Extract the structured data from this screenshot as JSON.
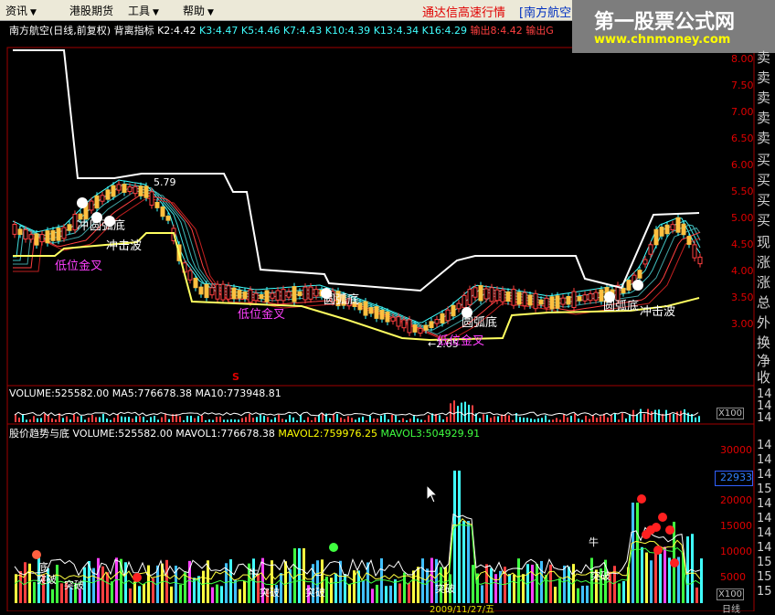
{
  "menubar": {
    "items": [
      {
        "label": "资讯",
        "has_arrow": true
      },
      {
        "label": "港股期货",
        "has_arrow": false
      },
      {
        "label": "工具",
        "has_arrow": true
      },
      {
        "label": "帮助",
        "has_arrow": true
      }
    ],
    "ticker": "通达信高速行情",
    "ticker_stock": "[南方航空"
  },
  "watermark": {
    "title": "第一股票公式网",
    "url": "www.chnmoney.com"
  },
  "main_panel": {
    "header_prefix": "南方航空(日线,前复权) 背离指标",
    "indicators": [
      {
        "label": "K2:4.42",
        "color": "#ffffff"
      },
      {
        "label": "K3:4.47",
        "color": "#40ffff"
      },
      {
        "label": "K5:4.46",
        "color": "#40ffff"
      },
      {
        "label": "K7:4.43",
        "color": "#40ffff"
      },
      {
        "label": "K10:4.39",
        "color": "#40ffff"
      },
      {
        "label": "K13:4.34",
        "color": "#40ffff"
      },
      {
        "label": "K16:4.29",
        "color": "#40ffff"
      },
      {
        "label": "输出8:4.42",
        "color": "#ff4040"
      },
      {
        "label": "输出G",
        "color": "#ff4040"
      }
    ],
    "y_axis": [
      "8.00",
      "7.50",
      "7.00",
      "6.50",
      "6.00",
      "5.50",
      "5.00",
      "4.50",
      "4.00",
      "3.50",
      "3.00"
    ],
    "price_annotations": [
      {
        "text": "5.79",
        "color": "#ffffff"
      },
      {
        "text": "←2.65",
        "color": "#ffffff"
      }
    ],
    "annotations": [
      {
        "text": "冲",
        "color": "#ffffff"
      },
      {
        "text": "圆弧底",
        "color": "#ffffff"
      },
      {
        "text": "冲击波",
        "color": "#ffffff"
      },
      {
        "text": "低位金叉",
        "color": "#ff40ff"
      },
      {
        "text": "低位金叉",
        "color": "#ff40ff"
      },
      {
        "text": "圆弧底",
        "color": "#ffffff"
      },
      {
        "text": "圆弧底",
        "color": "#ffffff"
      },
      {
        "text": "低位金叉",
        "color": "#ff40ff"
      },
      {
        "text": "圆弧底",
        "color": "#ffffff"
      },
      {
        "text": "冲击波",
        "color": "#ffffff"
      }
    ],
    "s_marker": "S"
  },
  "right_panel": {
    "labels": [
      "卖",
      "卖",
      "卖",
      "卖",
      "卖",
      "买",
      "买",
      "买",
      "买",
      "现",
      "涨",
      "涨",
      "总",
      "外",
      "换",
      "净",
      "收"
    ]
  },
  "volume_panel": {
    "header": [
      {
        "label": "VOLUME:525582.00",
        "color": "#ffffff"
      },
      {
        "label": "MA5:776678.38",
        "color": "#ffffff"
      },
      {
        "label": "MA10:773948.81",
        "color": "#ffffff"
      }
    ],
    "right_labels": [
      "14",
      "14",
      "14",
      "14"
    ],
    "badge": "X100"
  },
  "trend_panel": {
    "header": [
      {
        "label": "股价趋势与底 VOLUME:525582.00",
        "color": "#ffffff"
      },
      {
        "label": "MAVOL1:776678.38",
        "color": "#ffffff"
      },
      {
        "label": "MAVOL2:759976.25",
        "color": "#ffff00"
      },
      {
        "label": "MAVOL3:504929.91",
        "color": "#40ff40"
      }
    ],
    "y_axis": [
      "30000",
      "25000",
      "20000",
      "15000",
      "10000",
      "5000"
    ],
    "readout": "22933",
    "badge": "X100",
    "right_labels": [
      "14",
      "14",
      "14",
      "15",
      "14",
      "14",
      "14",
      "14",
      "15",
      "15",
      "15",
      "15"
    ],
    "annotations": [
      {
        "text": "底",
        "color": "#ffffff"
      },
      {
        "text": "突破",
        "color": "#ffffff"
      },
      {
        "text": "突破",
        "color": "#ffffff"
      },
      {
        "text": "牛",
        "color": "#ffffff"
      },
      {
        "text": "突破",
        "color": "#ffffff"
      },
      {
        "text": "突破",
        "color": "#ffffff"
      },
      {
        "text": "突破",
        "color": "#ffffff"
      },
      {
        "text": "牛",
        "color": "#ffffff"
      },
      {
        "text": "突破",
        "color": "#ffffff"
      }
    ],
    "date_label": "2009/11/27/五",
    "period_label": "日线"
  }
}
